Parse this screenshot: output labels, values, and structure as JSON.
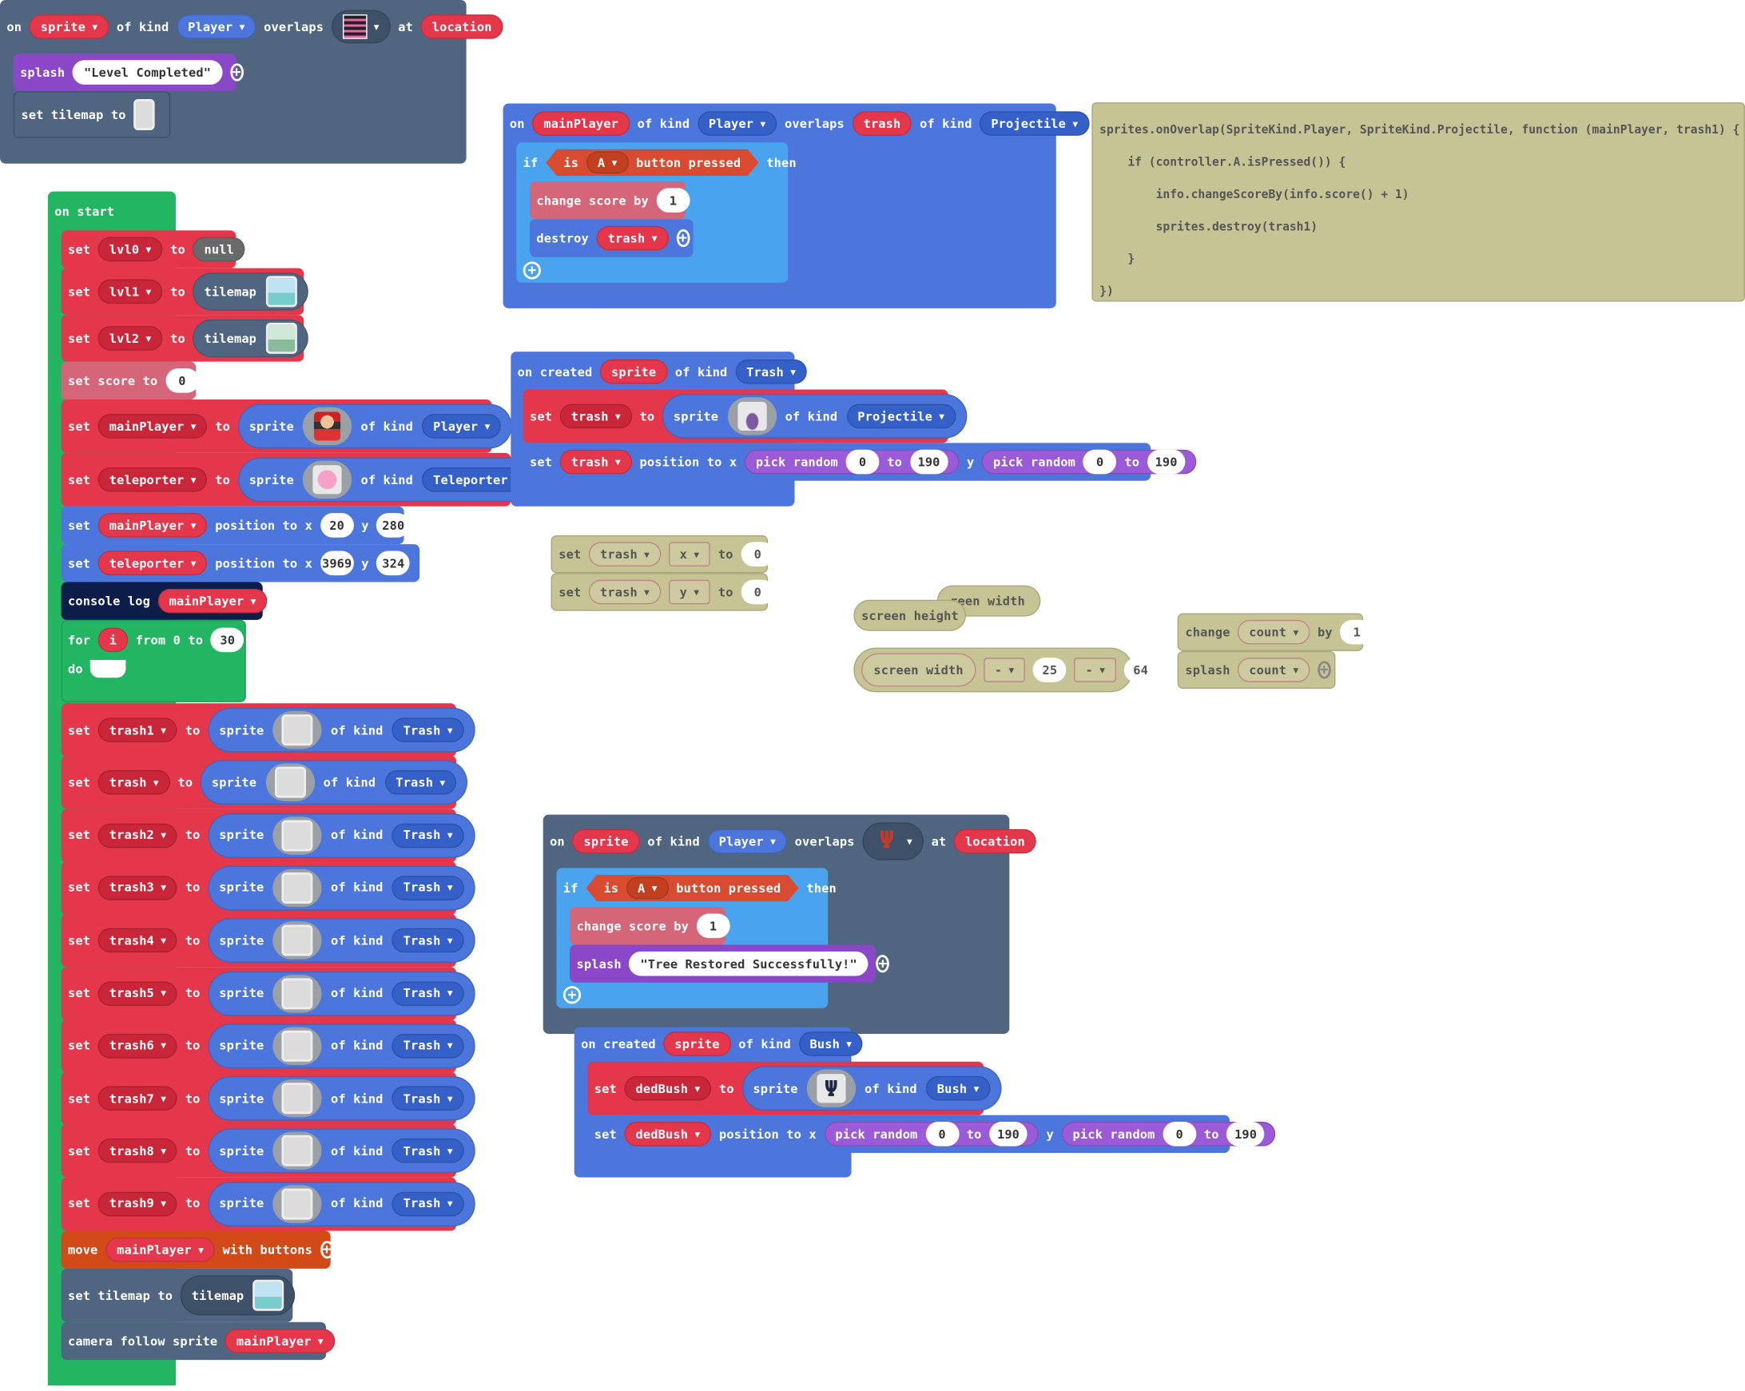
{
  "overlap1": {
    "on": "on",
    "sprite": "sprite",
    "of_kind": "of kind",
    "kind": "Player",
    "overlaps": "overlaps",
    "at": "at",
    "location": "location"
  },
  "splash1": {
    "label": "splash",
    "text": "\"Level Completed\""
  },
  "set_tilemap1": {
    "label": "set tilemap to"
  },
  "on_start": {
    "header": "on start",
    "set": "set",
    "to": "to",
    "null": "null",
    "tilemap": "tilemap",
    "lvl0": "lvl0",
    "lvl1": "lvl1",
    "lvl2": "lvl2",
    "set_score": "set score to",
    "score_value": "0",
    "mainPlayer": "mainPlayer",
    "teleporter": "teleporter",
    "sprite": "sprite",
    "of_kind": "of kind",
    "kind_player": "Player",
    "kind_teleporter": "Teleporter",
    "kind_trash": "Trash",
    "position_to_x": "position to x",
    "y": "y",
    "mp_x": "20",
    "mp_y": "280",
    "tp_x": "3969",
    "tp_y": "324",
    "console_log": "console log",
    "for": "for",
    "i": "i",
    "from": "from 0 to",
    "for_to": "30",
    "do": "do",
    "trash_rows": [
      {
        "var": "trash1"
      },
      {
        "var": "trash"
      },
      {
        "var": "trash2"
      },
      {
        "var": "trash3"
      },
      {
        "var": "trash4"
      },
      {
        "var": "trash5"
      },
      {
        "var": "trash6"
      },
      {
        "var": "trash7"
      },
      {
        "var": "trash8"
      },
      {
        "var": "trash9"
      }
    ],
    "move": "move",
    "with_buttons": "with buttons",
    "set_tilemap_to": "set tilemap to",
    "camera_follow": "camera follow sprite"
  },
  "overlap2": {
    "on": "on",
    "mainPlayer": "mainPlayer",
    "of_kind": "of kind",
    "kind1": "Player",
    "overlaps": "overlaps",
    "trash": "trash",
    "kind2": "Projectile",
    "if": "if",
    "is": "is",
    "button": "A",
    "button_pressed": "button pressed",
    "then": "then",
    "change_score": "change score by",
    "score_delta": "1",
    "destroy": "destroy"
  },
  "code": {
    "lines": [
      "sprites.onOverlap(SpriteKind.Player, SpriteKind.Projectile, function (mainPlayer, trash1) {",
      "    if (controller.A.isPressed()) {",
      "        info.changeScoreBy(info.score() + 1)",
      "        sprites.destroy(trash1)",
      "    }",
      "})"
    ]
  },
  "created1": {
    "on_created": "on created",
    "sprite": "sprite",
    "of_kind": "of kind",
    "kind": "Trash",
    "set": "set",
    "trash": "trash",
    "to": "to",
    "kind2": "Projectile",
    "position_to_x": "position to x",
    "pick_random": "pick random",
    "from": "0",
    "to_label": "to",
    "max": "190",
    "y": "y"
  },
  "loose": {
    "set": "set",
    "trash": "trash",
    "x": "x",
    "y": "y",
    "to": "to",
    "zero": "0",
    "screen_height": "screen height",
    "screen_width_partial": "reen width",
    "screen_width": "screen width",
    "minus": "-",
    "val25": "25",
    "val64": "64",
    "change": "change",
    "count": "count",
    "by": "by",
    "one": "1",
    "splash": "splash"
  },
  "overlap3": {
    "on": "on",
    "sprite": "sprite",
    "of_kind": "of kind",
    "kind": "Player",
    "overlaps": "overlaps",
    "at": "at",
    "location": "location",
    "if": "if",
    "is": "is",
    "button": "A",
    "button_pressed": "button pressed",
    "then": "then",
    "change_score": "change score by",
    "score_delta": "1",
    "splash": "splash",
    "text": "\"Tree Restored Successfully!\""
  },
  "created2": {
    "on_created": "on created",
    "sprite": "sprite",
    "of_kind": "of kind",
    "kind": "Bush",
    "set": "set",
    "dedBush": "dedBush",
    "to": "to",
    "position_to_x": "position to x",
    "pick_random": "pick random",
    "from": "0",
    "to_label": "to",
    "max": "190",
    "y": "y"
  }
}
